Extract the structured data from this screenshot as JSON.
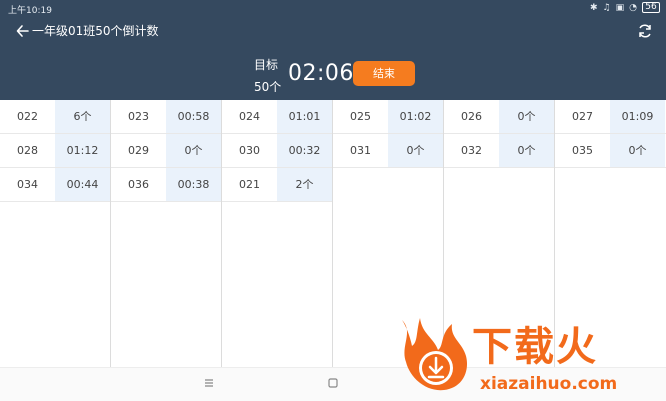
{
  "status_bar": {
    "time": "上午10:19",
    "battery": "56",
    "icons": [
      "bluetooth-icon",
      "mute-icon",
      "box-icon",
      "wifi-icon",
      "battery-icon"
    ]
  },
  "header": {
    "title": "一年级01班50个倒计数",
    "goal_label": "目标",
    "goal_value": "50个",
    "timer": "02:06",
    "end_label": "结束",
    "bg_color": "#35495f",
    "accent_color": "#f57c1f"
  },
  "columns": [
    {
      "rows": [
        {
          "id": "022",
          "value": "6个"
        },
        {
          "id": "028",
          "value": "01:12"
        },
        {
          "id": "034",
          "value": "00:44"
        }
      ]
    },
    {
      "rows": [
        {
          "id": "023",
          "value": "00:58"
        },
        {
          "id": "029",
          "value": "0个"
        },
        {
          "id": "036",
          "value": "00:38"
        }
      ]
    },
    {
      "rows": [
        {
          "id": "024",
          "value": "01:01"
        },
        {
          "id": "030",
          "value": "00:32"
        },
        {
          "id": "021",
          "value": "2个"
        }
      ]
    },
    {
      "rows": [
        {
          "id": "025",
          "value": "01:02"
        },
        {
          "id": "031",
          "value": "0个"
        }
      ]
    },
    {
      "rows": [
        {
          "id": "026",
          "value": "0个"
        },
        {
          "id": "032",
          "value": "0个"
        }
      ]
    },
    {
      "rows": [
        {
          "id": "027",
          "value": "01:09"
        },
        {
          "id": "035",
          "value": "0个"
        }
      ]
    }
  ],
  "watermark": {
    "brand": "下载火",
    "url": "xiazaihuo.com",
    "color": "#f26a1b"
  }
}
